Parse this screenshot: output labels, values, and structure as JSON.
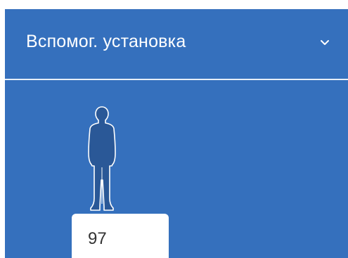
{
  "panel": {
    "background_color": "#3570bd",
    "header": {
      "title": "Вспомог. установка",
      "toggle_icon": "chevron-down-icon",
      "expanded": true
    },
    "person_icon": "person-silhouette-icon",
    "value_field": {
      "value": "97"
    }
  }
}
